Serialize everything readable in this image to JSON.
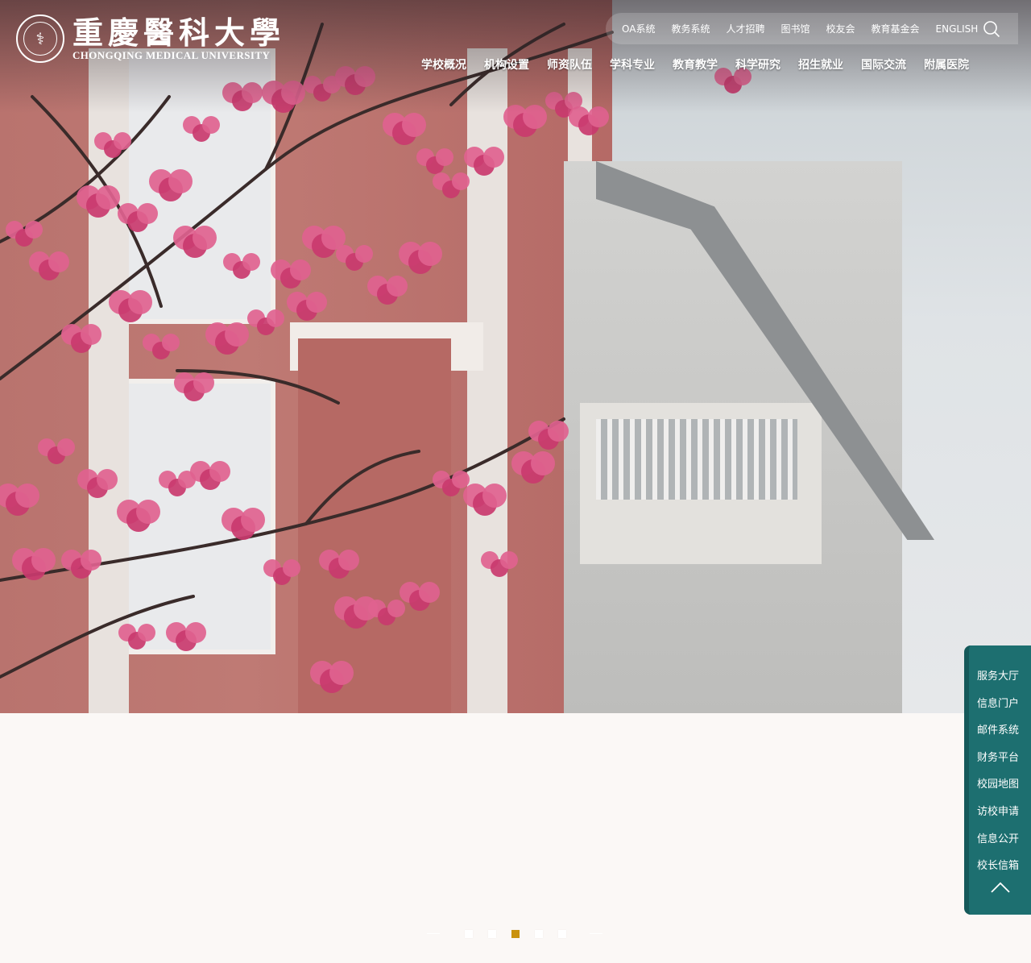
{
  "header": {
    "logo_cn": "重慶醫科大學",
    "logo_en": "CHONGQING MEDICAL UNIVERSITY"
  },
  "toplinks": [
    "OA系统",
    "教务系统",
    "人才招聘",
    "图书馆",
    "校友会",
    "教育基金会",
    "ENGLISH"
  ],
  "nav": [
    "学校概况",
    "机构设置",
    "师资队伍",
    "学科专业",
    "教育教学",
    "科学研究",
    "招生就业",
    "国际交流",
    "附属医院"
  ],
  "sidepanel": [
    "服务大厅",
    "信息门户",
    "邮件系统",
    "财务平台",
    "校园地图",
    "访校申请",
    "信息公开",
    "校长信箱"
  ],
  "carousel": {
    "slides": 5,
    "active": 3
  },
  "colors": {
    "panel": "#1d6f70",
    "active_dot": "#c9920e"
  },
  "icons": {
    "search": "search-icon",
    "back_to_top": "chevron-up-icon"
  }
}
